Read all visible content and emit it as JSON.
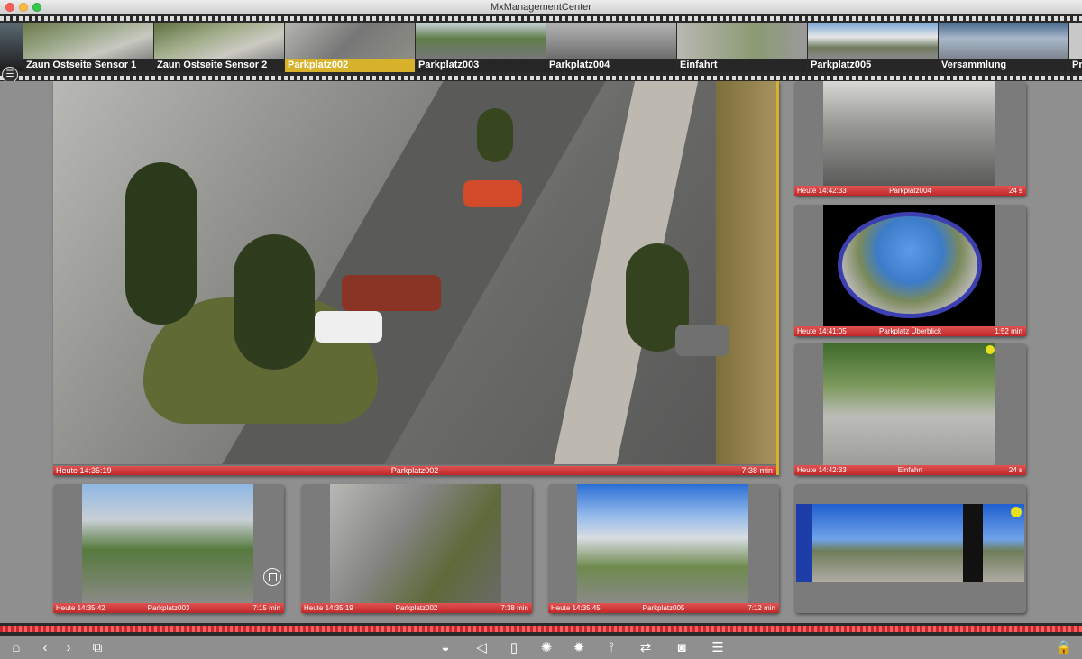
{
  "window": {
    "title": "MxManagementCenter"
  },
  "filmstrip": {
    "items": [
      {
        "label": "Zaun Ostseite Sensor 1",
        "active": false
      },
      {
        "label": "Zaun Ostseite Sensor 2",
        "active": false
      },
      {
        "label": "Parkplatz002",
        "active": true
      },
      {
        "label": "Parkplatz003",
        "active": false
      },
      {
        "label": "Parkplatz004",
        "active": false
      },
      {
        "label": "Einfahrt",
        "active": false
      },
      {
        "label": "Parkplatz005",
        "active": false
      },
      {
        "label": "Versammlung",
        "active": false
      },
      {
        "label": "Pr",
        "active": false
      }
    ]
  },
  "main": {
    "time": "Heute 14:35:19",
    "name": "Parkplatz002",
    "age": "7:38 min"
  },
  "right": [
    {
      "time": "Heute 14:42:33",
      "name": "Parkplatz004",
      "age": "24 s"
    },
    {
      "time": "Heute 14:41:05",
      "name": "Parkplatz Überblick",
      "age": "1:52 min"
    },
    {
      "time": "Heute 14:42:33",
      "name": "Einfahrt",
      "age": "24 s"
    }
  ],
  "bottom": [
    {
      "time": "Heute 14:35:42",
      "name": "Parkplatz003",
      "age": "7:15 min"
    },
    {
      "time": "Heute 14:35:19",
      "name": "Parkplatz002",
      "age": "7:38 min"
    },
    {
      "time": "Heute 14:35:45",
      "name": "Parkplatz005",
      "age": "7:12 min"
    }
  ],
  "toolbar": {
    "icons": {
      "home": "⌂",
      "back": "‹",
      "forward": "›",
      "layout": "⧉",
      "dome": "◒",
      "speaker": "◁",
      "door": "▯",
      "light_on": "✺",
      "light_off": "✹",
      "thermo": "⫯",
      "arrows": "⇄",
      "camera": "◙",
      "list": "☰",
      "lock": "🔒"
    }
  }
}
